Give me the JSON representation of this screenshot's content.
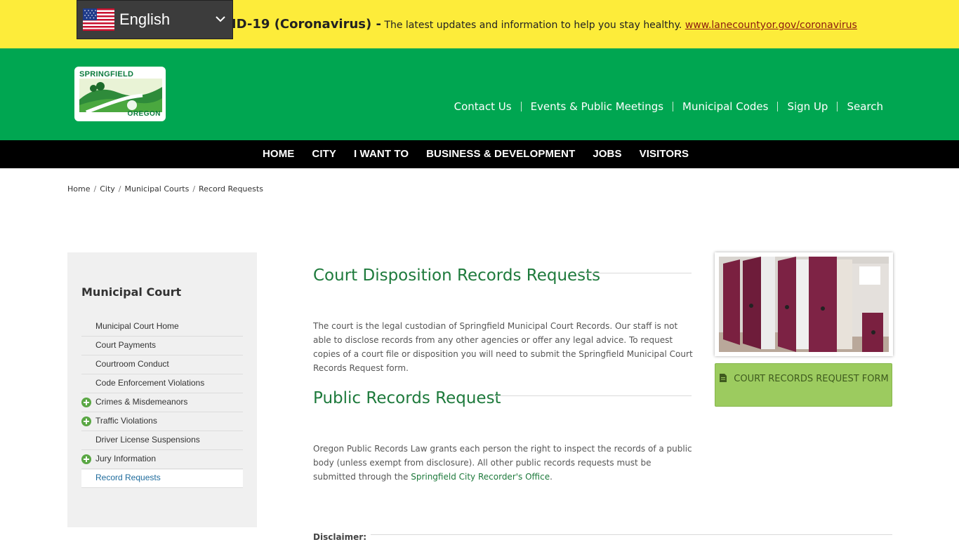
{
  "alert": {
    "title": "VID-19 (Coronavirus) -",
    "text": " The latest updates and information to help you stay healthy. ",
    "link": "www.lanecountyor.gov/coronavirus"
  },
  "language": {
    "selected": "English",
    "flag": "us-flag-icon"
  },
  "logo": {
    "top": "SPRINGFIELD",
    "bottom": "OREGON"
  },
  "utility_nav": [
    "Contact Us",
    "Events & Public Meetings",
    "Municipal Codes",
    "Sign Up",
    "Search"
  ],
  "main_nav": [
    "HOME",
    "CITY",
    "I WANT TO",
    "BUSINESS & DEVELOPMENT",
    "JOBS",
    "VISITORS"
  ],
  "breadcrumb": [
    "Home",
    "City",
    "Municipal Courts",
    "Record Requests"
  ],
  "sidebar": {
    "title": "Municipal Court",
    "items": [
      {
        "label": "Municipal Court Home",
        "expandable": false
      },
      {
        "label": "Court Payments",
        "expandable": false
      },
      {
        "label": "Courtroom Conduct",
        "expandable": false
      },
      {
        "label": "Code Enforcement Violations",
        "expandable": false
      },
      {
        "label": "Crimes & Misdemeanors",
        "expandable": true
      },
      {
        "label": "Traffic Violations",
        "expandable": true
      },
      {
        "label": "Driver License Suspensions",
        "expandable": false
      },
      {
        "label": "Jury Information",
        "expandable": true
      },
      {
        "label": "Record Requests",
        "expandable": false,
        "active": true
      }
    ]
  },
  "content": {
    "section1": {
      "heading": "Court Disposition Records Requests",
      "body": "The court is the legal custodian of Springfield Municipal Court Records. Our staff is not able to disclose records from any other agencies or offer any legal advice.  To request copies of a court file or disposition you will need to submit the Springfield Municipal Court Records Request form."
    },
    "section2": {
      "heading": "Public Records Request",
      "body": "Oregon Public Records Law grants each person the right to inspect the records of a public body (unless exempt from disclosure). All other public records requests must be submitted through the ",
      "link": "Springfield City Recorder's Office",
      "end": "."
    },
    "disclaimer": "Disclaimer:"
  },
  "aside": {
    "button_label": "COURT RECORDS REQUEST FORM",
    "button_icon": "document-icon"
  },
  "colors": {
    "alert_bg": "#fdec3a",
    "header_green": "#00a651",
    "nav_black": "#000000",
    "heading_green": "#1e7a3c",
    "button_green": "#9ccb5f"
  }
}
